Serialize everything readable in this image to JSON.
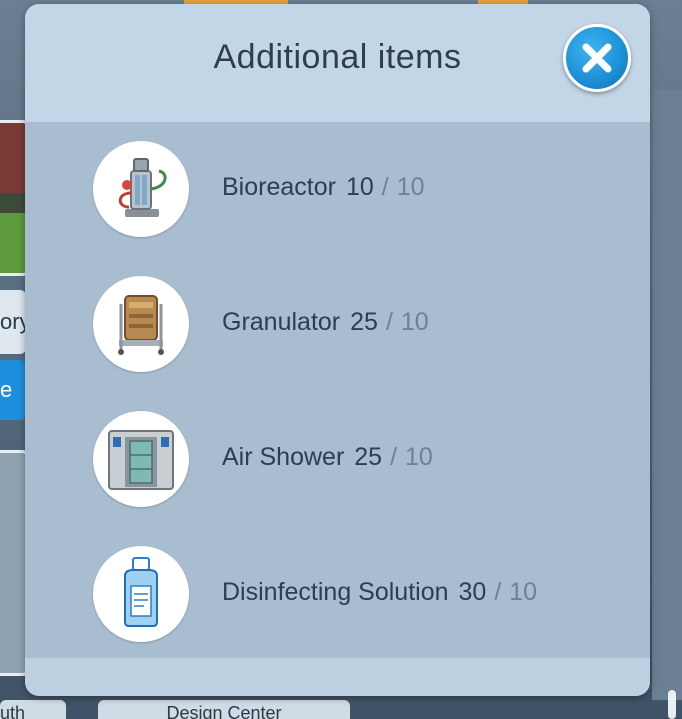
{
  "dialog": {
    "title": "Additional items"
  },
  "items": [
    {
      "name": "Bioreactor",
      "have": "10",
      "separator": "/",
      "need": "10",
      "icon": "bioreactor-icon"
    },
    {
      "name": "Granulator",
      "have": "25",
      "separator": "/",
      "need": "10",
      "icon": "granulator-icon"
    },
    {
      "name": "Air Shower",
      "have": "25",
      "separator": "/",
      "need": "10",
      "icon": "air-shower-icon"
    },
    {
      "name": "Disinfecting Solution",
      "have": "30",
      "separator": "/",
      "need": "10",
      "icon": "disinfecting-solution-icon"
    }
  ],
  "background": {
    "left_label": "ory",
    "left_button": "e",
    "bottom_tab_left": "uth",
    "bottom_tab_right": "Design Center"
  },
  "colors": {
    "close_button": "#1c8fd6",
    "panel": "#bcd0e2",
    "list_bg": "#a9bdd0"
  }
}
